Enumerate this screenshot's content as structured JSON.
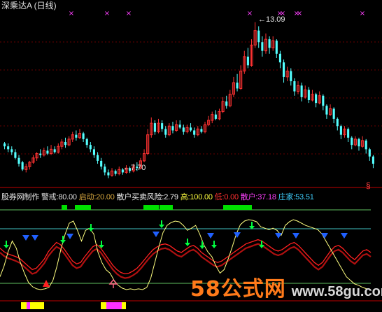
{
  "window": {
    "title": "深乘达A (日线)"
  },
  "price_chart": {
    "high_label": "13.09",
    "low_label": "7.70",
    "high_arrow_glyph": "←",
    "low_arrow_glyph": "←",
    "candles": [
      [
        8.9,
        8.8,
        8.95,
        8.7
      ],
      [
        8.8,
        8.7,
        8.9,
        8.6
      ],
      [
        8.7,
        8.6,
        8.8,
        8.5
      ],
      [
        8.6,
        8.4,
        8.7,
        8.35
      ],
      [
        8.4,
        8.2,
        8.5,
        8.1
      ],
      [
        8.25,
        8.0,
        8.3,
        7.95
      ],
      [
        8.0,
        8.1,
        8.2,
        7.9
      ],
      [
        8.1,
        8.25,
        8.3,
        8.0
      ],
      [
        8.25,
        8.4,
        8.5,
        8.2
      ],
      [
        8.4,
        8.55,
        8.6,
        8.3
      ],
      [
        8.55,
        8.5,
        8.7,
        8.4
      ],
      [
        8.5,
        8.65,
        8.75,
        8.45
      ],
      [
        8.65,
        8.55,
        8.8,
        8.5
      ],
      [
        8.55,
        8.7,
        8.85,
        8.5
      ],
      [
        8.7,
        8.6,
        8.8,
        8.55
      ],
      [
        8.6,
        8.8,
        8.9,
        8.55
      ],
      [
        8.8,
        8.95,
        9.05,
        8.7
      ],
      [
        8.95,
        8.85,
        9.1,
        8.75
      ],
      [
        8.85,
        9.05,
        9.15,
        8.8
      ],
      [
        9.05,
        9.2,
        9.3,
        8.95
      ],
      [
        9.2,
        9.1,
        9.35,
        9.0
      ],
      [
        9.1,
        9.25,
        9.4,
        9.05
      ],
      [
        9.25,
        9.05,
        9.3,
        8.95
      ],
      [
        9.05,
        8.85,
        9.1,
        8.75
      ],
      [
        8.85,
        8.7,
        8.95,
        8.6
      ],
      [
        8.7,
        8.5,
        8.8,
        8.4
      ],
      [
        8.5,
        8.3,
        8.6,
        8.2
      ],
      [
        8.3,
        8.1,
        8.4,
        8.0
      ],
      [
        8.1,
        7.9,
        8.2,
        7.8
      ],
      [
        7.9,
        7.8,
        8.0,
        7.7
      ],
      [
        7.8,
        7.95,
        8.05,
        7.75
      ],
      [
        7.95,
        7.85,
        8.0,
        7.78
      ],
      [
        7.85,
        8.0,
        8.1,
        7.8
      ],
      [
        8.0,
        7.9,
        8.05,
        7.82
      ],
      [
        7.9,
        8.05,
        8.15,
        7.85
      ],
      [
        8.05,
        7.95,
        8.1,
        7.88
      ],
      [
        7.95,
        8.1,
        8.2,
        7.9
      ],
      [
        8.1,
        8.05,
        8.25,
        7.95
      ],
      [
        8.05,
        8.3,
        8.4,
        8.0
      ],
      [
        8.3,
        8.55,
        8.7,
        8.25
      ],
      [
        8.55,
        9.2,
        9.4,
        8.5
      ],
      [
        9.2,
        9.6,
        9.8,
        9.1
      ],
      [
        9.6,
        9.3,
        9.7,
        9.2
      ],
      [
        9.3,
        9.6,
        9.75,
        9.25
      ],
      [
        9.6,
        9.4,
        9.7,
        9.3
      ],
      [
        9.4,
        9.2,
        9.5,
        9.1
      ],
      [
        9.2,
        9.5,
        9.6,
        9.15
      ],
      [
        9.5,
        9.35,
        9.65,
        9.25
      ],
      [
        9.35,
        9.55,
        9.7,
        9.3
      ],
      [
        9.55,
        9.45,
        9.7,
        9.4
      ],
      [
        9.45,
        9.3,
        9.55,
        9.2
      ],
      [
        9.3,
        9.45,
        9.55,
        9.25
      ],
      [
        9.45,
        9.35,
        9.6,
        9.3
      ],
      [
        9.35,
        9.2,
        9.45,
        9.1
      ],
      [
        9.2,
        9.4,
        9.5,
        9.15
      ],
      [
        9.4,
        9.3,
        9.5,
        9.25
      ],
      [
        9.3,
        9.55,
        9.65,
        9.25
      ],
      [
        9.55,
        9.7,
        9.85,
        9.5
      ],
      [
        9.7,
        9.9,
        10.0,
        9.6
      ],
      [
        9.9,
        9.75,
        10.05,
        9.7
      ],
      [
        9.75,
        10.0,
        10.1,
        9.7
      ],
      [
        10.0,
        10.35,
        10.5,
        9.95
      ],
      [
        10.35,
        10.2,
        10.55,
        10.1
      ],
      [
        10.2,
        10.6,
        10.75,
        10.15
      ],
      [
        10.6,
        11.0,
        11.2,
        10.5
      ],
      [
        11.0,
        10.8,
        11.3,
        10.7
      ],
      [
        10.8,
        11.4,
        11.6,
        10.75
      ],
      [
        11.4,
        11.9,
        12.1,
        11.3
      ],
      [
        11.9,
        11.6,
        12.2,
        11.5
      ],
      [
        11.6,
        12.3,
        12.5,
        11.55
      ],
      [
        12.3,
        12.8,
        13.09,
        12.2
      ],
      [
        12.8,
        12.4,
        12.95,
        12.2
      ],
      [
        12.4,
        12.1,
        12.6,
        11.9
      ],
      [
        12.1,
        12.5,
        12.7,
        12.0
      ],
      [
        12.5,
        12.2,
        12.6,
        12.0
      ],
      [
        12.2,
        12.45,
        12.6,
        12.1
      ],
      [
        12.45,
        12.0,
        12.5,
        11.85
      ],
      [
        12.0,
        11.7,
        12.1,
        11.5
      ],
      [
        11.7,
        11.2,
        11.8,
        11.0
      ],
      [
        11.2,
        11.4,
        11.55,
        11.05
      ],
      [
        11.4,
        11.05,
        11.5,
        10.9
      ],
      [
        11.05,
        10.7,
        11.15,
        10.55
      ],
      [
        10.7,
        10.9,
        11.05,
        10.6
      ],
      [
        10.9,
        10.5,
        11.0,
        10.35
      ],
      [
        10.5,
        10.75,
        10.9,
        10.45
      ],
      [
        10.75,
        10.4,
        10.85,
        10.3
      ],
      [
        10.4,
        10.6,
        10.75,
        10.35
      ],
      [
        10.6,
        10.3,
        10.65,
        10.15
      ],
      [
        10.3,
        10.55,
        10.7,
        10.25
      ],
      [
        10.55,
        10.2,
        10.6,
        10.05
      ],
      [
        10.2,
        9.9,
        10.25,
        9.75
      ],
      [
        9.9,
        10.1,
        10.25,
        9.85
      ],
      [
        10.1,
        9.75,
        10.15,
        9.6
      ],
      [
        9.75,
        9.5,
        9.8,
        9.35
      ],
      [
        9.5,
        9.2,
        9.55,
        9.05
      ],
      [
        9.2,
        9.4,
        9.5,
        9.1
      ],
      [
        9.4,
        9.1,
        9.45,
        8.95
      ],
      [
        9.1,
        8.85,
        9.15,
        8.7
      ],
      [
        8.85,
        9.05,
        9.15,
        8.8
      ],
      [
        9.05,
        8.8,
        9.1,
        8.65
      ],
      [
        8.8,
        9.0,
        9.15,
        8.75
      ],
      [
        9.0,
        8.7,
        9.05,
        8.55
      ],
      [
        8.7,
        8.45,
        8.75,
        8.3
      ],
      [
        8.45,
        8.2,
        8.5,
        8.05
      ]
    ]
  },
  "indicator": {
    "name": "股券网制作",
    "warn_label": "警戒:",
    "warn_value": "80.00",
    "start_label": "启动:",
    "start_value": "20.00",
    "risk_label": "散户买卖风险:",
    "risk_value": "2.79",
    "high_label": "高:",
    "high_value": "100.00",
    "low_label": "低:",
    "low_value": "0.00",
    "retail_label": "散户:",
    "retail_value": "37.18",
    "dealer_label": "庄家:",
    "dealer_value": "53.51",
    "levels": [
      80,
      50,
      20
    ],
    "yellow_line": [
      20,
      35,
      55,
      70,
      60,
      40,
      25,
      12,
      6,
      3,
      2,
      3,
      5,
      15,
      35,
      60,
      80,
      95,
      98,
      85,
      70,
      85,
      88,
      80,
      55,
      40,
      30,
      25,
      15,
      8,
      4,
      2,
      3,
      2,
      3,
      2,
      5,
      18,
      40,
      62,
      82,
      92,
      96,
      98,
      97,
      92,
      85,
      88,
      92,
      80,
      65,
      55,
      48,
      35,
      25,
      30,
      45,
      62,
      80,
      93,
      98,
      100,
      99,
      97,
      90,
      88,
      86,
      88,
      85,
      78,
      92,
      97,
      100,
      98,
      95,
      92,
      90,
      88,
      86,
      80,
      70,
      60,
      50,
      40,
      30,
      20,
      15,
      10,
      8,
      5,
      3,
      2
    ],
    "red_line": [
      60,
      55,
      52,
      50,
      48,
      45,
      40,
      35,
      30,
      32,
      38,
      45,
      55,
      62,
      68,
      65,
      58,
      50,
      42,
      38,
      40,
      48,
      55,
      62,
      65,
      60,
      52,
      44,
      36,
      30,
      26,
      24,
      25,
      28,
      32,
      38,
      45,
      52,
      58,
      62,
      65,
      66,
      64,
      60,
      56,
      54,
      58,
      62,
      64,
      60,
      54,
      50,
      46,
      42,
      40,
      42,
      46,
      50,
      54,
      58,
      62,
      66,
      68,
      70,
      72,
      70,
      66,
      62,
      58,
      56,
      58,
      62,
      66,
      68,
      64,
      58,
      52,
      46,
      40,
      36,
      40,
      48,
      56,
      62,
      64,
      60,
      54,
      48,
      44,
      50,
      56,
      58,
      54
    ],
    "signal_markers": [
      {
        "type": "green-down-arrow",
        "name": "green-down-arrow-icon"
      },
      {
        "type": "blue-down-triangle",
        "name": "blue-down-triangle-icon"
      },
      {
        "type": "red-up-triangle",
        "name": "red-up-triangle-icon"
      },
      {
        "type": "pink-up-arrow",
        "name": "pink-up-arrow-icon"
      }
    ],
    "colors": {
      "bg": "#000000",
      "candle_up": "#ff3232",
      "candle_down": "#54ffff",
      "yellow_line": "#ffff80",
      "red_line": "#ff2020",
      "green_block": "#00e000",
      "blue_marker": "#2060ff",
      "grid_dash": "#c00000",
      "level_cyan": "#40c0c0",
      "level_green": "#60c060",
      "warn_bottom_yellow": "#ffff00",
      "warn_bottom_magenta": "#ff30ff",
      "top_marker": "#ff40ff"
    }
  },
  "watermark": {
    "big": "58公式网",
    "url": "www.58gu.com",
    "small_glyph": "§"
  }
}
